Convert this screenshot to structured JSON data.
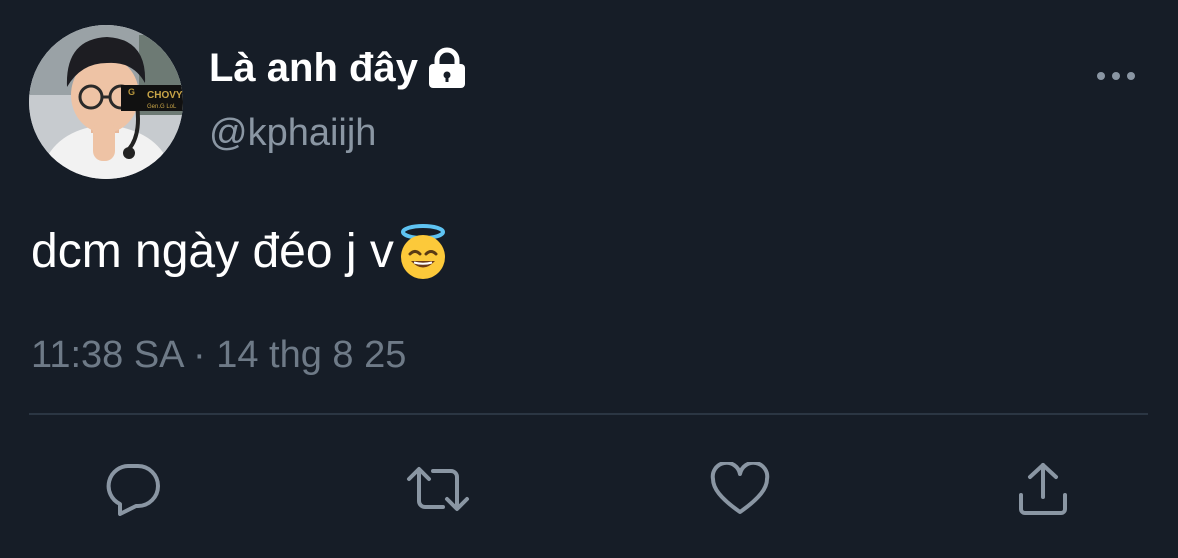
{
  "tweet": {
    "author": {
      "display_name": "Là anh đây",
      "handle": "@kphaiijh",
      "protected_icon": "lock-icon",
      "avatar_badge": {
        "brand": "CHOVY",
        "team": "Gen.G LoL"
      }
    },
    "text": "dcm ngày đéo j v",
    "emoji": "smiling-face-with-halo",
    "timestamp": "11:38 SA · 14 thg 8 25"
  },
  "actions": {
    "reply_icon": "reply-icon",
    "retweet_icon": "retweet-icon",
    "like_icon": "heart-icon",
    "share_icon": "share-icon",
    "more_icon": "more-icon"
  },
  "colors": {
    "background": "#161d27",
    "primary_text": "#ffffff",
    "secondary_text": "#8a96a3",
    "icon": "#8a96a3",
    "divider": "#2b3643"
  }
}
